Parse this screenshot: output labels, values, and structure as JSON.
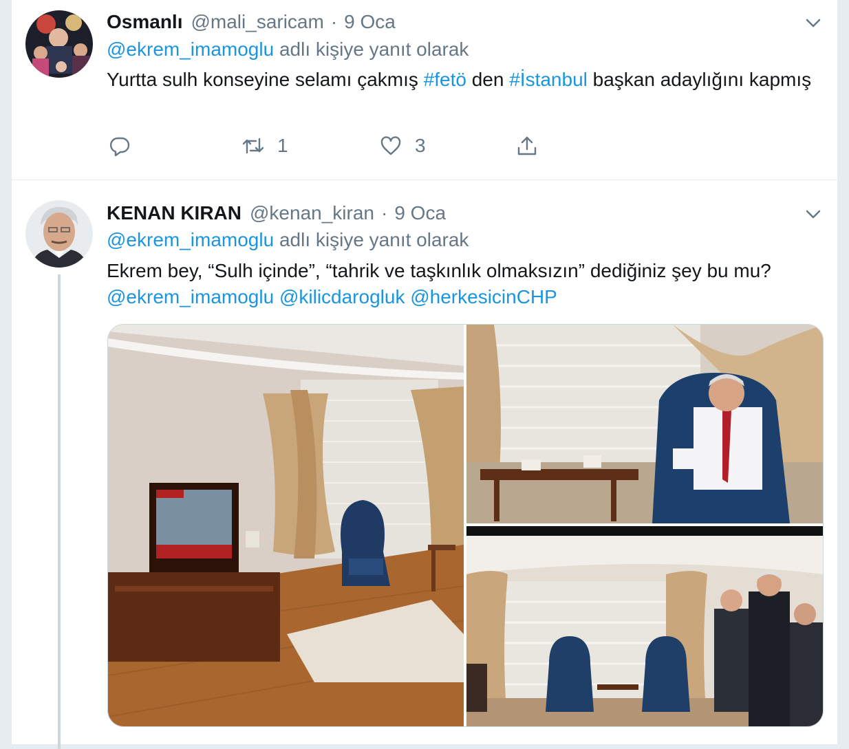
{
  "tweets": [
    {
      "name": "Osmanlı",
      "handle": "@mali_saricam",
      "separator": "·",
      "date": "9 Oca",
      "reply_to_link": "@ekrem_imamoglu",
      "reply_suffix": " adlı kişiye yanıt olarak",
      "text_parts": [
        "Yurtta sulh konseyine selamı çakmış ",
        "#fetö",
        " den ",
        "#İstanbul",
        " başkan adaylığını kapmış"
      ],
      "retweet_count": "1",
      "like_count": "3"
    },
    {
      "name": "KENAN KIRAN",
      "handle": "@kenan_kiran",
      "separator": "·",
      "date": "9 Oca",
      "reply_to_link": "@ekrem_imamoglu",
      "reply_suffix": " adlı kişiye yanıt olarak",
      "text_parts": [
        "Ekrem bey, “Sulh içinde”, “tahrik ve taşkınlık olmaksızın” dediğiniz şey bu mu? ",
        "@ekrem_imamoglu",
        " ",
        "@kilicdarogluk",
        " ",
        "@herkesicinCHP"
      ],
      "media_count": 3
    }
  ],
  "icons": {
    "reply": "reply-icon",
    "retweet": "retweet-icon",
    "like": "heart-icon",
    "share": "share-icon",
    "caret": "chevron-down-icon"
  },
  "colors": {
    "link": "#1b95e0",
    "secondary_text": "#657786",
    "primary_text": "#14171a",
    "border": "#e6ecf0"
  }
}
